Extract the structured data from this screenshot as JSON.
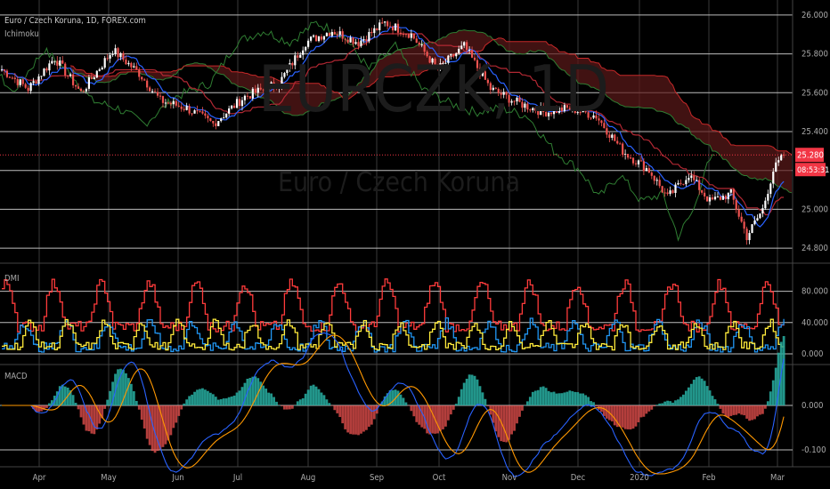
{
  "title": "Euro / Czech Koruna, 1D, FOREX.com",
  "watermark_symbol": "EURCZK, 1D",
  "watermark_name": "Euro / Czech Koruna",
  "colors": {
    "up": "#ffffff",
    "down": "#ef5350",
    "cloud": "#5c1a1a",
    "conversion": "#2962ff",
    "base": "#b22833",
    "lagging": "#2f7d32",
    "lead_a": "#2e7d32",
    "lead_b": "#c62828",
    "dmi_plus": "#2196f3",
    "dmi_minus": "#ff3b3b",
    "adx": "#ffeb3b",
    "macd": "#2962ff",
    "signal": "#ff9800",
    "hist_up": "#26a69a",
    "hist_down": "#ef5350",
    "price_tag": "#f23645"
  },
  "chart_data": [
    {
      "type": "line",
      "name": "Ichimoku",
      "label": "Ichimoku",
      "y_ticks": [
        "26.000",
        "25.800",
        "25.600",
        "25.400",
        "25.200",
        "25.000",
        "24.800"
      ],
      "ylim": [
        24.75,
        26.05
      ],
      "x_ticks": [
        "Apr",
        "May",
        "Jun",
        "Jul",
        "Aug",
        "Sep",
        "Oct",
        "Nov",
        "Dec",
        "2020",
        "Feb",
        "Mar"
      ],
      "last_price": "25.280",
      "countdown": "08:53:31",
      "price_points": [
        [
          0,
          25.72
        ],
        [
          10,
          25.62
        ],
        [
          20,
          25.78
        ],
        [
          30,
          25.6
        ],
        [
          42,
          25.82
        ],
        [
          52,
          25.7
        ],
        [
          60,
          25.56
        ],
        [
          70,
          25.52
        ],
        [
          80,
          25.44
        ],
        [
          92,
          25.58
        ],
        [
          105,
          25.65
        ],
        [
          115,
          25.86
        ],
        [
          125,
          25.92
        ],
        [
          135,
          25.86
        ],
        [
          145,
          25.96
        ],
        [
          155,
          25.9
        ],
        [
          165,
          25.72
        ],
        [
          175,
          25.84
        ],
        [
          185,
          25.62
        ],
        [
          195,
          25.55
        ],
        [
          205,
          25.5
        ],
        [
          215,
          25.52
        ],
        [
          225,
          25.48
        ],
        [
          235,
          25.3
        ],
        [
          245,
          25.2
        ],
        [
          252,
          25.06
        ],
        [
          260,
          25.18
        ],
        [
          268,
          25.04
        ],
        [
          276,
          25.08
        ],
        [
          282,
          24.86
        ],
        [
          288,
          25.0
        ],
        [
          292,
          25.2
        ],
        [
          296,
          25.28
        ]
      ]
    },
    {
      "type": "line",
      "name": "DMI",
      "label": "DMI",
      "y_ticks": [
        "80.000",
        "40.000",
        "0.000"
      ],
      "ylim": [
        0,
        100
      ]
    },
    {
      "type": "line",
      "name": "MACD",
      "label": "MACD",
      "y_ticks": [
        "0.000",
        "-0.100"
      ],
      "ylim": [
        -0.125,
        0.06
      ]
    }
  ]
}
